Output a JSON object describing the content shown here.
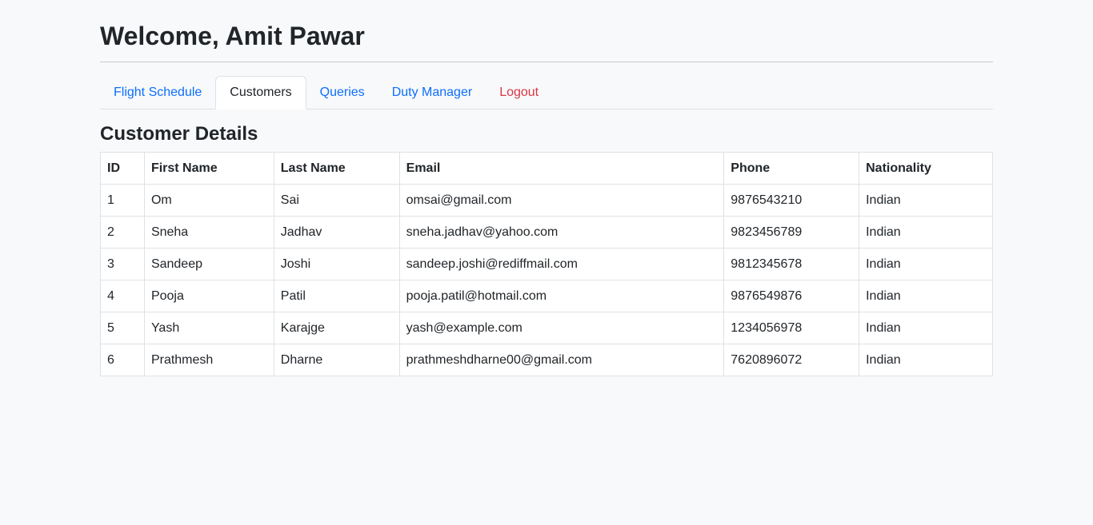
{
  "header": {
    "welcome": "Welcome, Amit Pawar"
  },
  "nav": {
    "tabs": [
      {
        "label": "Flight Schedule"
      },
      {
        "label": "Customers"
      },
      {
        "label": "Queries"
      },
      {
        "label": "Duty Manager"
      },
      {
        "label": "Logout"
      }
    ],
    "active_tab": "Customers"
  },
  "section": {
    "title": "Customer Details"
  },
  "table": {
    "columns": [
      "ID",
      "First Name",
      "Last Name",
      "Email",
      "Phone",
      "Nationality"
    ],
    "rows": [
      [
        "1",
        "Om",
        "Sai",
        "omsai@gmail.com",
        "9876543210",
        "Indian"
      ],
      [
        "2",
        "Sneha",
        "Jadhav",
        "sneha.jadhav@yahoo.com",
        "9823456789",
        "Indian"
      ],
      [
        "3",
        "Sandeep",
        "Joshi",
        "sandeep.joshi@rediffmail.com",
        "9812345678",
        "Indian"
      ],
      [
        "4",
        "Pooja",
        "Patil",
        "pooja.patil@hotmail.com",
        "9876549876",
        "Indian"
      ],
      [
        "5",
        "Yash",
        "Karajge",
        "yash@example.com",
        "1234056978",
        "Indian"
      ],
      [
        "6",
        "Prathmesh",
        "Dharne",
        "prathmeshdharne00@gmail.com",
        "7620896072",
        "Indian"
      ]
    ]
  },
  "colors": {
    "link": "#0d6efd",
    "logout": "#dc3545",
    "text": "#212529",
    "background": "#f8f9fa",
    "border": "#dee2e6"
  }
}
